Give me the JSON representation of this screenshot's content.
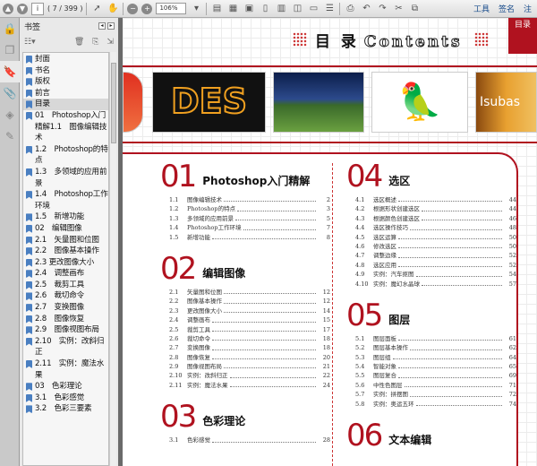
{
  "toolbar": {
    "page_current": "i",
    "page_info": "( 7 / 399 )",
    "zoom": "106%",
    "tools": "工具",
    "sign": "签名",
    "comment": "注"
  },
  "panel": {
    "title": "书签"
  },
  "bookmarks": [
    {
      "label": "封面"
    },
    {
      "label": "书名"
    },
    {
      "label": "版权"
    },
    {
      "label": "前言"
    },
    {
      "label": "目录",
      "selected": true
    },
    {
      "label": "01　Photoshop入门精解1.1　图像编辑技术"
    },
    {
      "label": "1.2　Photoshop的特点"
    },
    {
      "label": "1.3　多领域的应用前景"
    },
    {
      "label": "1.4　Photoshop工作环境"
    },
    {
      "label": "1.5　新增功能"
    },
    {
      "label": "02　编辑图像"
    },
    {
      "label": "2.1　矢量图和位图"
    },
    {
      "label": "2.2　图像基本操作"
    },
    {
      "label": "2.3 更改图像大小"
    },
    {
      "label": "2.4　调整画布"
    },
    {
      "label": "2.5　裁剪工具"
    },
    {
      "label": "2.6　裁切命令"
    },
    {
      "label": "2.7　变换图像"
    },
    {
      "label": "2.8　图像恢复"
    },
    {
      "label": "2.9　图像视图布局"
    },
    {
      "label": "2.10　实例：改斜归正"
    },
    {
      "label": "2.11　实例：魔法水果"
    },
    {
      "label": "03　色彩理论"
    },
    {
      "label": "3.1　色彩感觉"
    },
    {
      "label": "3.2　色彩三要素"
    }
  ],
  "page": {
    "title_cn": "目 录",
    "title_en": "Contents",
    "tab": "目录",
    "des_text": "DES",
    "autumn_text": "Isubas",
    "left": [
      {
        "num": "01",
        "title": "Photoshop入门精解",
        "items": [
          [
            "1.1",
            "图像编辑技术",
            "2"
          ],
          [
            "1.2",
            "Photoshop的特点",
            "3"
          ],
          [
            "1.3",
            "多领域的应用前景",
            "5"
          ],
          [
            "1.4",
            "Photoshop工作环境",
            "7"
          ],
          [
            "1.5",
            "新增功能",
            "8"
          ]
        ]
      },
      {
        "num": "02",
        "title": "编辑图像",
        "items": [
          [
            "2.1",
            "矢量图和位图",
            "12"
          ],
          [
            "2.2",
            "图像基本操作",
            "12"
          ],
          [
            "2.3",
            "更改图像大小",
            "14"
          ],
          [
            "2.4",
            "调整画布",
            "15"
          ],
          [
            "2.5",
            "裁剪工具",
            "17"
          ],
          [
            "2.6",
            "裁切命令",
            "18"
          ],
          [
            "2.7",
            "变换图像",
            "18"
          ],
          [
            "2.8",
            "图像恢复",
            "20"
          ],
          [
            "2.9",
            "图像视图布局",
            "21"
          ],
          [
            "2.10",
            "实例：改斜归正",
            "22"
          ],
          [
            "2.11",
            "实例：魔法水果",
            "24"
          ]
        ]
      },
      {
        "num": "03",
        "title": "色彩理论",
        "items": [
          [
            "3.1",
            "色彩感觉",
            "28"
          ]
        ]
      }
    ],
    "right": [
      {
        "num": "04",
        "title": "选区",
        "items": [
          [
            "4.1",
            "选区概述",
            "44"
          ],
          [
            "4.2",
            "根据形状创建选区",
            "44"
          ],
          [
            "4.3",
            "根据颜色创建选区",
            "46"
          ],
          [
            "4.4",
            "选区操作技巧",
            "48"
          ],
          [
            "4.5",
            "选区运算",
            "50"
          ],
          [
            "4.6",
            "修改选区",
            "50"
          ],
          [
            "4.7",
            "调整边缘",
            "52"
          ],
          [
            "4.8",
            "选区应用",
            "52"
          ],
          [
            "4.9",
            "实例：汽车抠图",
            "54"
          ],
          [
            "4.10",
            "实例：魔幻水晶球",
            "57"
          ]
        ]
      },
      {
        "num": "05",
        "title": "图层",
        "items": [
          [
            "5.1",
            "图层面板",
            "61"
          ],
          [
            "5.2",
            "图层基本操作",
            "62"
          ],
          [
            "5.3",
            "图层组",
            "64"
          ],
          [
            "5.4",
            "智能对象",
            "65"
          ],
          [
            "5.5",
            "图层复合",
            "69"
          ],
          [
            "5.6",
            "中性色图层",
            "71"
          ],
          [
            "5.7",
            "实例：拼摆图",
            "72"
          ],
          [
            "5.8",
            "实例：奥运五环",
            "74"
          ]
        ]
      },
      {
        "num": "06",
        "title": "文本编辑",
        "items": []
      }
    ]
  }
}
